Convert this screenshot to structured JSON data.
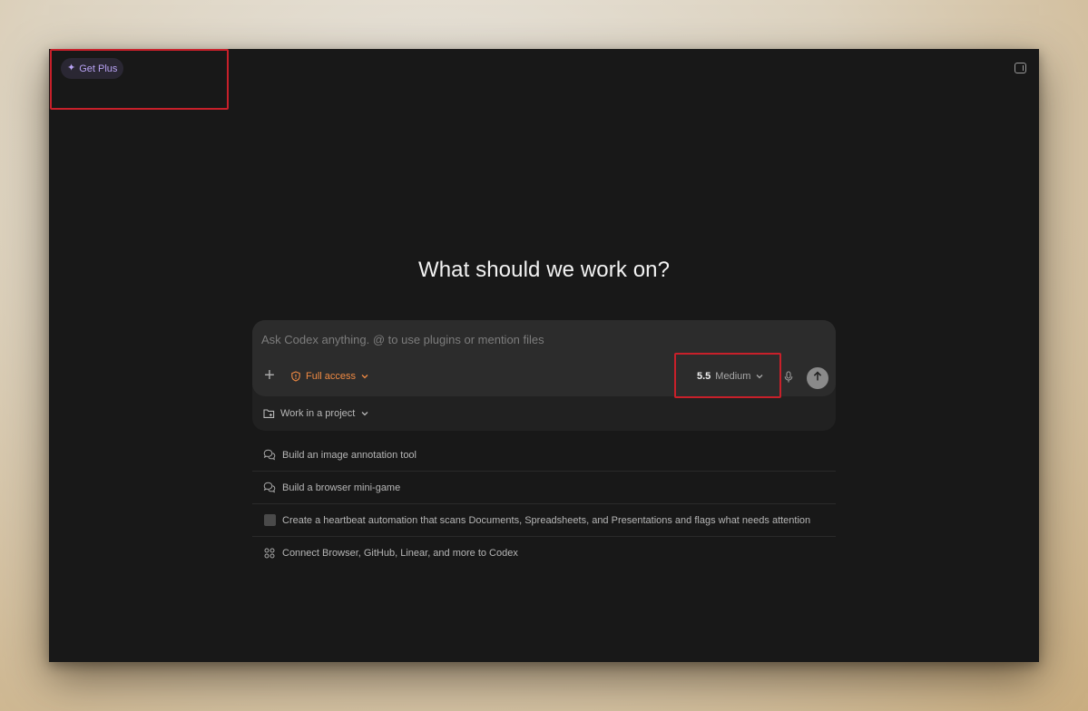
{
  "header": {
    "get_plus_label": "Get Plus",
    "sparkle_icon": "sparkle-icon",
    "panel_icon": "sidebar-toggle-icon"
  },
  "main": {
    "heading": "What should we work on?"
  },
  "composer": {
    "placeholder": "Ask Codex anything. @ to use plugins or mention files",
    "value": "",
    "access_label": "Full access",
    "model_version": "5.5",
    "model_effort": "Medium",
    "project_label": "Work in a project"
  },
  "suggestions": [
    {
      "label": "Build an image annotation tool",
      "icon": "chat-bubbles-icon"
    },
    {
      "label": "Build a browser mini-game",
      "icon": "chat-bubbles-icon"
    },
    {
      "label": "Create a heartbeat automation that scans Documents, Spreadsheets, and Presentations and flags what needs attention",
      "icon": "checkbox-icon"
    },
    {
      "label": "Connect Browser, GitHub, Linear, and more to Codex",
      "icon": "apps-grid-icon"
    }
  ],
  "colors": {
    "window_bg": "#181818",
    "composer_bg": "#2c2c2c",
    "accent_purple": "#b9a3f5",
    "access_orange": "#f08a43",
    "highlight_red": "#c8202a"
  }
}
